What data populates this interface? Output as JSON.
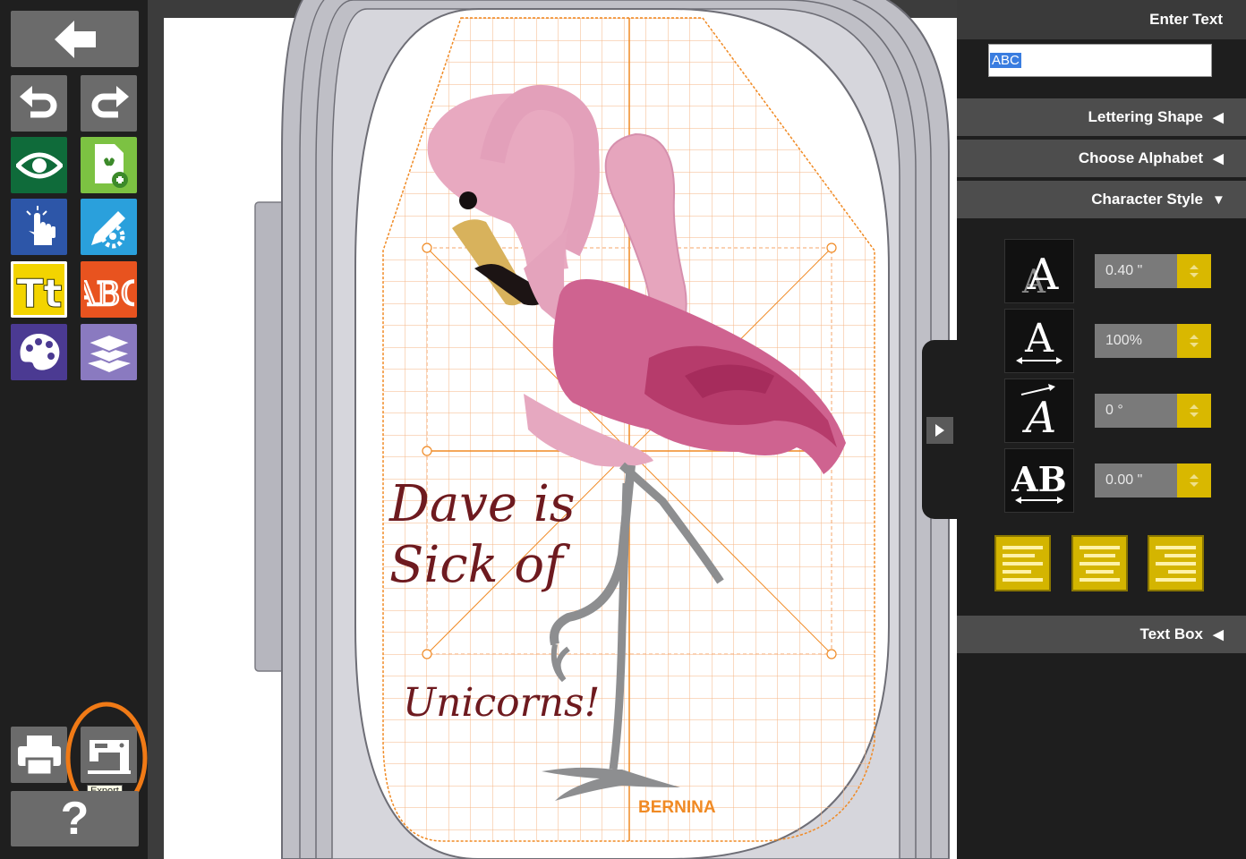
{
  "panel": {
    "enter_text_title": "Enter Text",
    "text_value": "ABC",
    "sections": {
      "lettering_shape": "Lettering Shape",
      "choose_alphabet": "Choose Alphabet",
      "character_style": "Character Style",
      "text_box": "Text Box"
    },
    "character_style": {
      "size": "0.40 \"",
      "width": "100%",
      "slant": "0 °",
      "spacing": "0.00 \""
    }
  },
  "toolbar": {
    "export_tooltip": "Export",
    "help_label": "?"
  },
  "canvas": {
    "text_lines": [
      "Dave  is",
      "Sick  of",
      "Unicorns!"
    ],
    "brand": "BERNINA"
  },
  "colors": {
    "accent_yellow": "#d9b800",
    "grid_orange": "#f08a24",
    "text_maroon": "#6e1a1f",
    "highlight_orange": "#f07a16"
  },
  "icons": {
    "back": "arrow-left-icon",
    "undo": "undo-icon",
    "redo": "redo-icon",
    "view": "eye-icon",
    "add_design": "add-file-icon",
    "select": "hand-pointer-icon",
    "edit": "pencil-gear-icon",
    "text": "text-tt-icon",
    "monogram": "abc-monogram-icon",
    "color": "palette-icon",
    "layers": "layers-icon",
    "print": "printer-icon",
    "export": "sewing-machine-icon",
    "help": "question-icon"
  }
}
